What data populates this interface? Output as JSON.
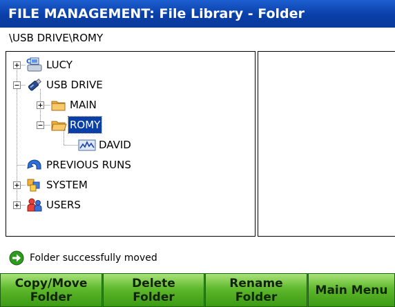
{
  "window": {
    "title": "FILE MANAGEMENT: File Library - Folder",
    "path": "\\USB DRIVE\\ROMY"
  },
  "tree": {
    "nodes": [
      {
        "label": "LUCY",
        "icon": "computer-icon",
        "expander": "+",
        "selected": false
      },
      {
        "label": "USB DRIVE",
        "icon": "usb-drive-icon",
        "expander": "-",
        "selected": false
      },
      {
        "label": "MAIN",
        "icon": "folder-icon",
        "expander": "+",
        "selected": false
      },
      {
        "label": "ROMY",
        "icon": "folder-open-icon",
        "expander": "-",
        "selected": true
      },
      {
        "label": "DAVID",
        "icon": "chart-file-icon",
        "expander": "",
        "selected": false
      },
      {
        "label": "PREVIOUS RUNS",
        "icon": "back-arrow-icon",
        "expander": "",
        "selected": false
      },
      {
        "label": "SYSTEM",
        "icon": "system-icon",
        "expander": "+",
        "selected": false
      },
      {
        "label": "USERS",
        "icon": "users-icon",
        "expander": "+",
        "selected": false
      }
    ]
  },
  "status": {
    "icon": "green-arrow-icon",
    "message": "Folder successfully moved"
  },
  "buttons": [
    {
      "line1": "Copy/Move",
      "line2": "Folder"
    },
    {
      "line1": "Delete",
      "line2": "Folder"
    },
    {
      "line1": "Rename",
      "line2": "Folder"
    },
    {
      "line1": "Main Menu",
      "line2": ""
    }
  ],
  "colors": {
    "title_bar": "#0a3fa8",
    "selection": "#0a3fa8",
    "button_green": "#5fb82c",
    "folder": "#f2b33d",
    "status_icon": "#2e9a1e"
  }
}
